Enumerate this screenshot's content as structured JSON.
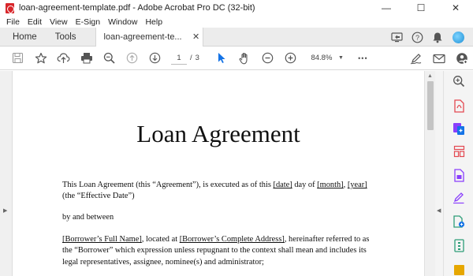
{
  "window": {
    "title": "loan-agreement-template.pdf - Adobe Acrobat Pro DC (32-bit)",
    "controls": {
      "minimize": "—",
      "maximize": "☐",
      "close": "✕"
    }
  },
  "menu": [
    "File",
    "Edit",
    "View",
    "E-Sign",
    "Window",
    "Help"
  ],
  "tabs": {
    "home": "Home",
    "tools": "Tools",
    "document": "loan-agreement-te...",
    "close": "✕"
  },
  "toolbar": {
    "current_page": "1",
    "page_separator": "/",
    "total_pages": "3",
    "zoom": "84.8%",
    "more": "•••"
  },
  "document": {
    "title": "Loan Agreement",
    "p1": {
      "a": "This Loan Agreement (this “Agreement”), is executed as of this ",
      "date": "[date]",
      "b": " day of ",
      "month": "[month]",
      "c": ", ",
      "year": "[year]",
      "d": " (the “Effective Date”)"
    },
    "p2": "by and between",
    "p3": {
      "name": "[Borrower’s Full Name]",
      "a": ", located at ",
      "address": "[Borrower’s Complete Address]",
      "b": ", hereinafter referred to as the “Borrower” which expression unless repugnant to the context shall mean and includes its legal representatives, assignee, nominee(s) and administrator;"
    }
  },
  "colors": {
    "accent": "#1473e6",
    "adobe_red": "#d8262b",
    "rail_export": "#e34850",
    "rail_purple": "#8a3ffc",
    "rail_green": "#2d9d78",
    "rail_yellow": "#e6a700"
  }
}
